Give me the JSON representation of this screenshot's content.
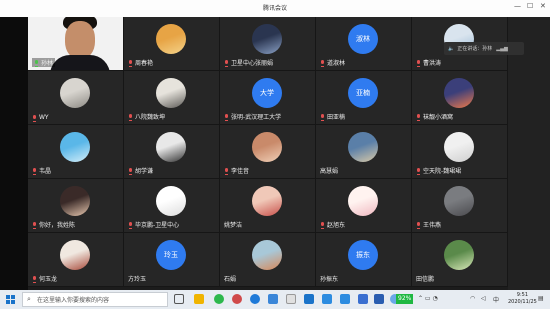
{
  "window": {
    "title": "腾讯会议"
  },
  "speaking": {
    "label": "正在讲话：孙林"
  },
  "participants": [
    {
      "name": "孙林",
      "type": "video",
      "mic": "on"
    },
    {
      "name": "周春艳",
      "type": "img",
      "colors": [
        "#e7a445",
        "#f4d38a"
      ],
      "mic": "off"
    },
    {
      "name": "卫星中心张丽娟",
      "type": "img",
      "colors": [
        "#2a3550",
        "#8aa0c4"
      ],
      "mic": "off"
    },
    {
      "name": "道淑林",
      "type": "text",
      "text": "淑林",
      "bg": "#2f7bf0",
      "mic": "off"
    },
    {
      "name": "曹洪涛",
      "type": "img",
      "colors": [
        "#d9e4ee",
        "#98b8d4"
      ],
      "mic": "off"
    },
    {
      "name": "WY",
      "type": "img",
      "colors": [
        "#d8d5cf",
        "#8d8a84"
      ],
      "mic": "off"
    },
    {
      "name": "八院魏致坤",
      "type": "img",
      "colors": [
        "#e6e3dc",
        "#5c5a56"
      ],
      "mic": "off"
    },
    {
      "name": "张明-武汉理工大学",
      "type": "text",
      "text": "大学",
      "bg": "#2f7bf0",
      "mic": "off"
    },
    {
      "name": "田亚楠",
      "type": "text",
      "text": "亚楠",
      "bg": "#2f7bf0",
      "mic": "off"
    },
    {
      "name": "袜靓小酒窝",
      "type": "img",
      "colors": [
        "#3b3f7a",
        "#f07a4a"
      ],
      "mic": "off"
    },
    {
      "name": "韦晶",
      "type": "img",
      "colors": [
        "#5ab7e8",
        "#d4eef8"
      ],
      "mic": "off"
    },
    {
      "name": "胡学谦",
      "type": "img",
      "colors": [
        "#e8e8e8",
        "#333333"
      ],
      "mic": "off"
    },
    {
      "name": "李佳音",
      "type": "img",
      "colors": [
        "#c98a6a",
        "#f0d0b8"
      ],
      "mic": "off"
    },
    {
      "name": "高慧娟",
      "type": "img",
      "colors": [
        "#5a7fa8",
        "#d8c9a8"
      ],
      "mic": null
    },
    {
      "name": "空天院-魏珺珺",
      "type": "img",
      "colors": [
        "#f0f0f0",
        "#cfcfcf"
      ],
      "mic": "off"
    },
    {
      "name": "你好，我姓陈",
      "type": "img",
      "colors": [
        "#3a2a28",
        "#e8c8b0"
      ],
      "mic": "off"
    },
    {
      "name": "毕京鹏-卫星中心",
      "type": "img",
      "colors": [
        "#ffffff",
        "#dddddd"
      ],
      "mic": "off"
    },
    {
      "name": "姚梦洁",
      "type": "img",
      "colors": [
        "#f0c8b8",
        "#c8504a"
      ],
      "mic": null
    },
    {
      "name": "赵旭东",
      "type": "img",
      "colors": [
        "#fff3f0",
        "#f0b8c0"
      ],
      "mic": "off"
    },
    {
      "name": "王伟燕",
      "type": "img",
      "colors": [
        "#7a7c80",
        "#4a4a4e"
      ],
      "mic": "off"
    },
    {
      "name": "何玉龙",
      "type": "img",
      "colors": [
        "#f0e8e0",
        "#a84a3a"
      ],
      "mic": "off"
    },
    {
      "name": "方玲玉",
      "type": "text",
      "text": "玲玉",
      "bg": "#2f7bf0",
      "mic": null
    },
    {
      "name": "石娟",
      "type": "img",
      "colors": [
        "#a8c8d8",
        "#d88858"
      ],
      "mic": null
    },
    {
      "name": "孙振东",
      "type": "text",
      "text": "振东",
      "bg": "#2f7bf0",
      "mic": null
    },
    {
      "name": "田信鹏",
      "type": "img",
      "colors": [
        "#5a8a4a",
        "#d8e8b8"
      ],
      "mic": null
    }
  ],
  "taskbar": {
    "search_placeholder": "在这里输入你要搜索的内容",
    "battery": "92%",
    "ime": "中",
    "time": "9:51",
    "date": "2020/11/25"
  }
}
